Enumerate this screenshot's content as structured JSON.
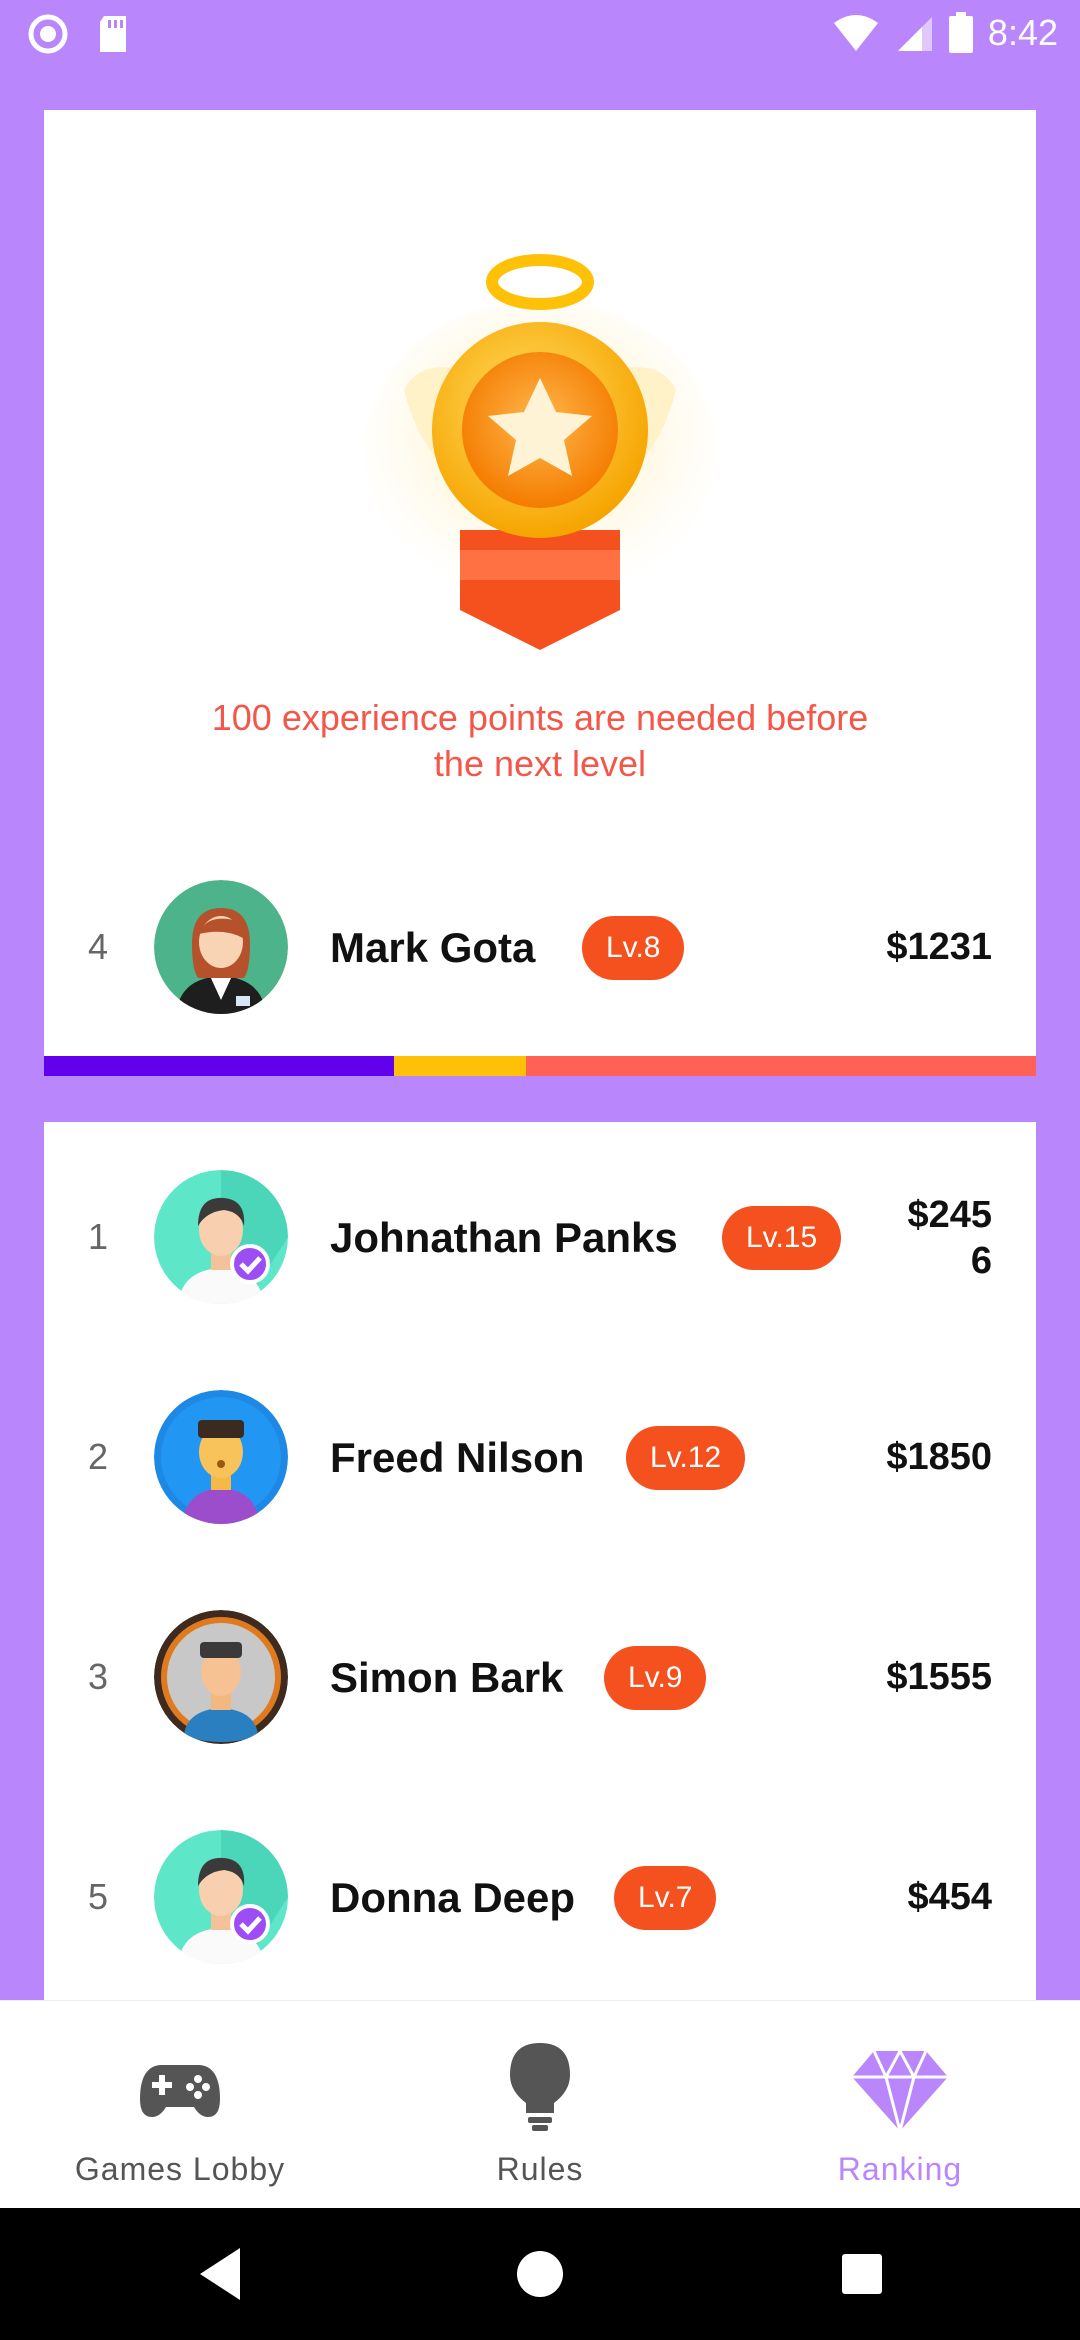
{
  "status_bar": {
    "time": "8:42",
    "icons": [
      "circle-app-icon",
      "sd-card-icon",
      "wifi-icon",
      "signal-icon",
      "battery-icon"
    ]
  },
  "current_user": {
    "exp_message_line1": "100 experience points are needed before",
    "exp_message_line2": "the next level",
    "rank": "4",
    "name": "Mark Gota",
    "level": "Lv.8",
    "money": "$1231",
    "progress": {
      "purple": 0.35,
      "yellow": 0.13,
      "red": 0.52
    }
  },
  "ranking": [
    {
      "rank": "1",
      "name": "Johnathan Panks",
      "level": "Lv.15",
      "money": "$2456"
    },
    {
      "rank": "2",
      "name": "Freed Nilson",
      "level": "Lv.12",
      "money": "$1850"
    },
    {
      "rank": "3",
      "name": "Simon Bark",
      "level": "Lv.9",
      "money": "$1555"
    },
    {
      "rank": "5",
      "name": "Donna Deep",
      "level": "Lv.7",
      "money": "$454"
    }
  ],
  "bottom_nav": {
    "games_lobby": "Games Lobby",
    "rules": "Rules",
    "ranking": "Ranking",
    "active": "Ranking"
  },
  "colors": {
    "background": "#BA86FB",
    "accent_red": "#F4574A",
    "level_badge": "#F4511E",
    "progress_purple": "#6200EE",
    "progress_yellow": "#FFC107",
    "progress_red": "#FF6157"
  }
}
